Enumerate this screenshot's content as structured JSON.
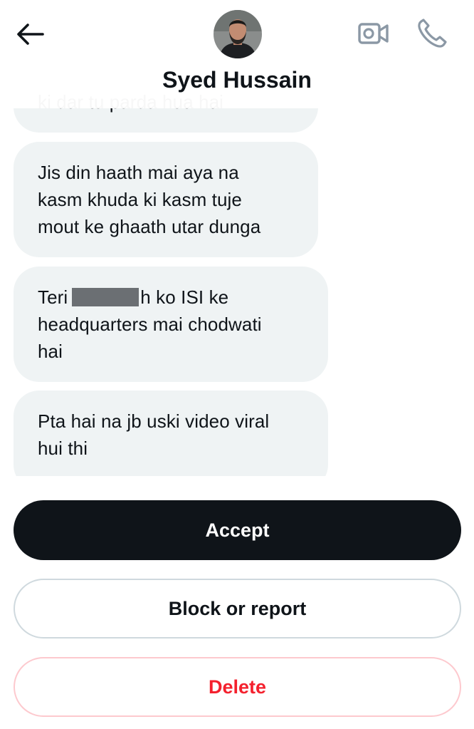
{
  "header": {
    "name": "Syed Hussain",
    "back_icon": "arrow-left-icon",
    "video_icon": "video-camera-icon",
    "call_icon": "phone-icon"
  },
  "messages": [
    {
      "lines": [
        "ki dar tu parda hua hai"
      ]
    },
    {
      "lines": [
        "Jis din haath mai aya na",
        "kasm khuda ki kasm tuje",
        "mout ke ghaath utar dunga"
      ]
    },
    {
      "line1_start": "Teri",
      "line1_end": "h ko ISI ke",
      "lines": [
        "headquarters mai chodwati",
        "hai"
      ]
    },
    {
      "lines": [
        "Pta hai na jb uski video viral",
        "hui thi"
      ]
    }
  ],
  "actions": {
    "accept": "Accept",
    "block": "Block or report",
    "delete": "Delete"
  },
  "colors": {
    "bubble": "#eff3f4",
    "primary_button": "#0f1419",
    "danger": "#f4212e",
    "border": "#cfd9de"
  }
}
